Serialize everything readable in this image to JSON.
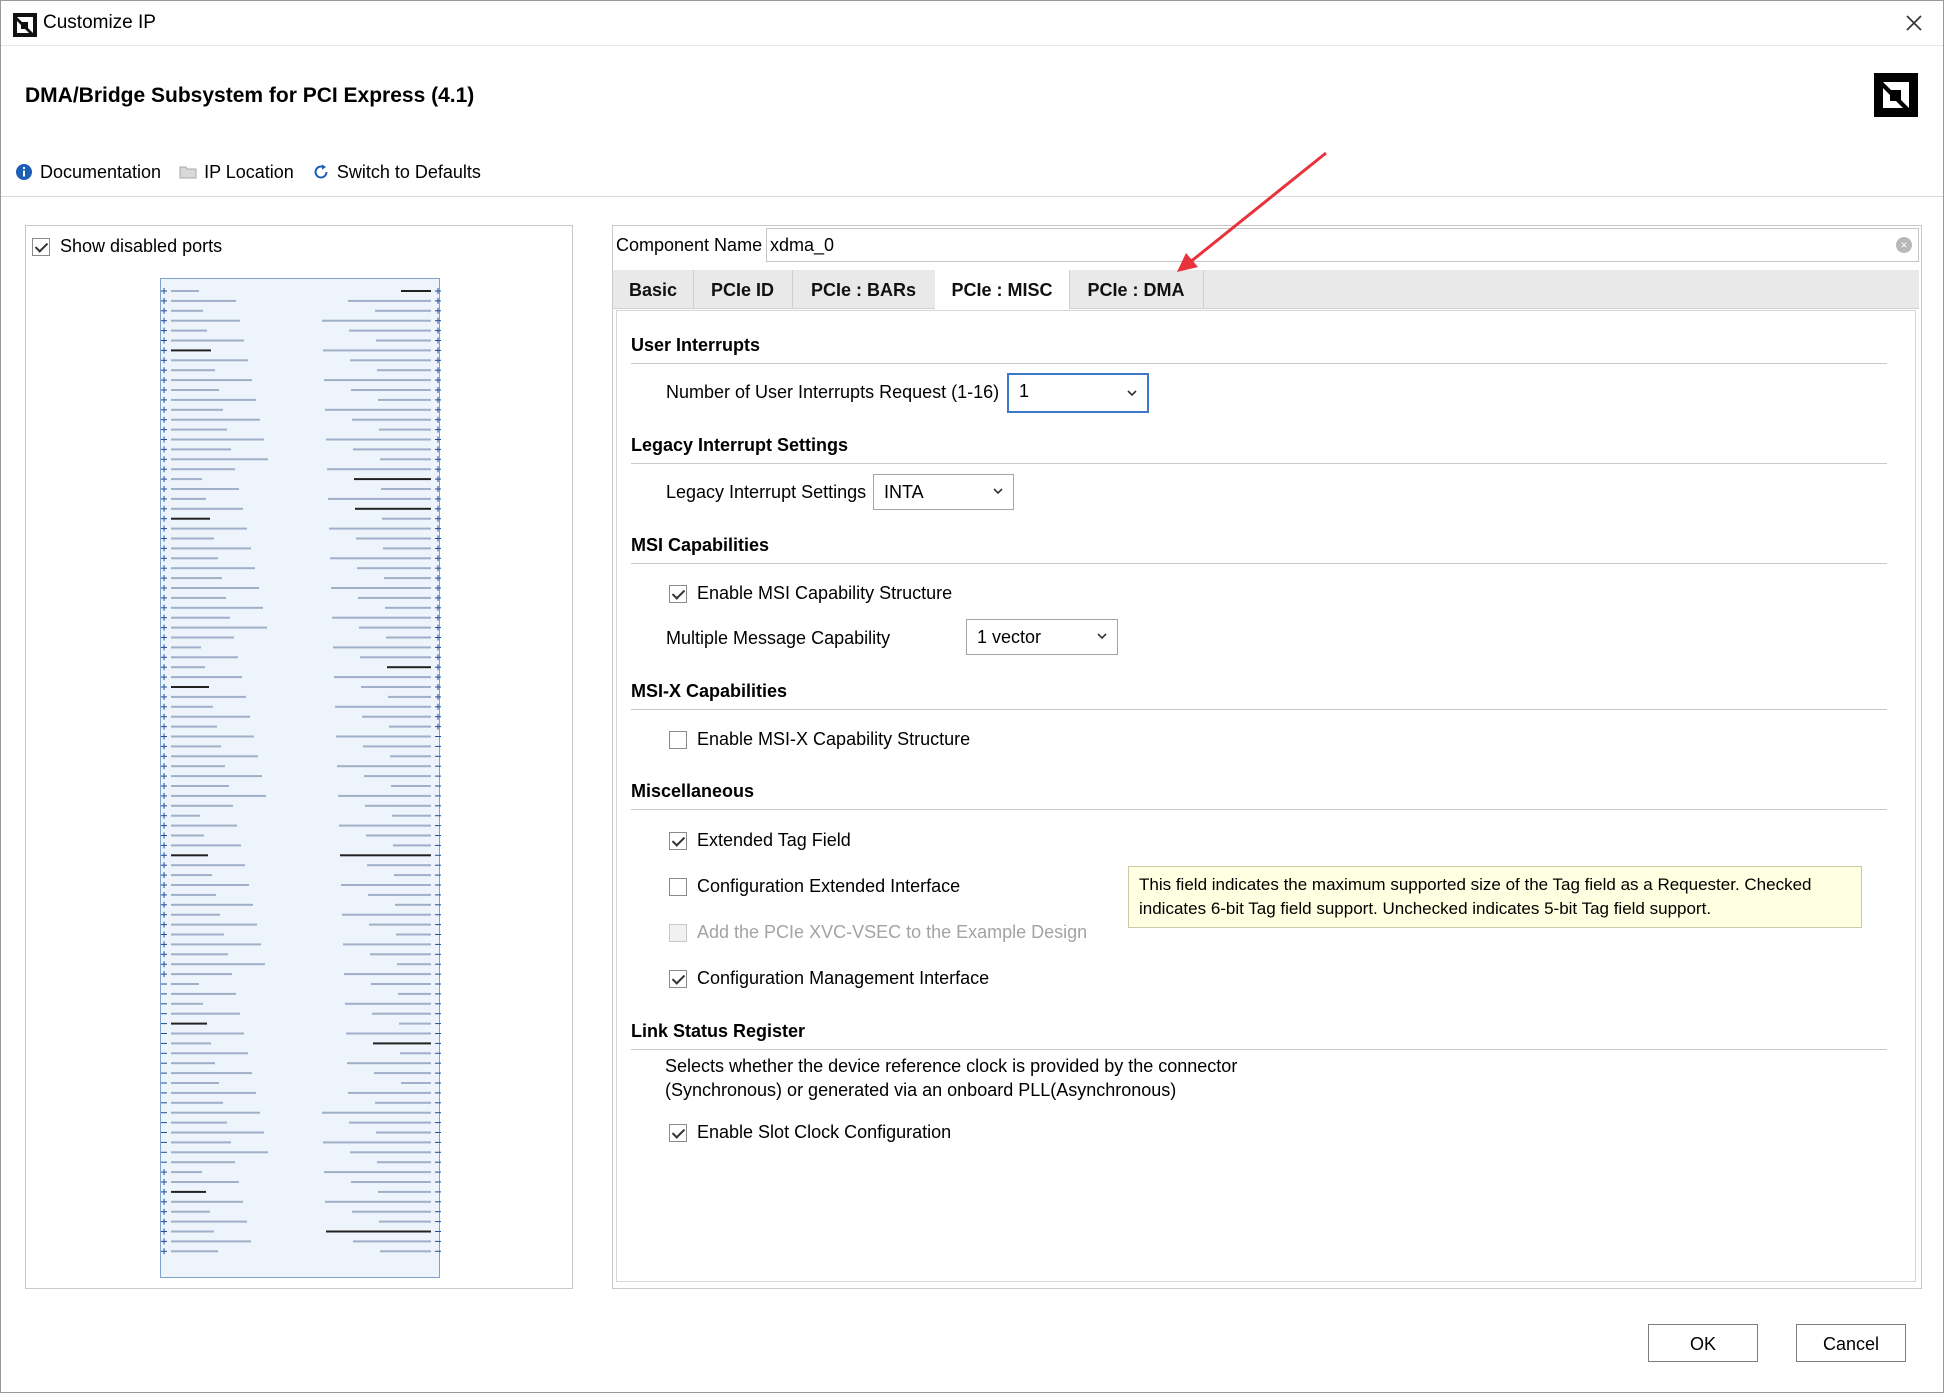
{
  "window": {
    "title": "Customize IP"
  },
  "header": {
    "ip_title": "DMA/Bridge Subsystem for PCI Express (4.1)",
    "toolbar": {
      "documentation": "Documentation",
      "ip_location": "IP Location",
      "switch_defaults": "Switch to Defaults"
    }
  },
  "left_panel": {
    "show_disabled_ports": {
      "label": "Show disabled ports",
      "checked": true
    }
  },
  "component": {
    "label": "Component Name",
    "value": "xdma_0"
  },
  "tabs": [
    {
      "label": "Basic",
      "active": false
    },
    {
      "label": "PCIe ID",
      "active": false
    },
    {
      "label": "PCIe : BARs",
      "active": false
    },
    {
      "label": "PCIe : MISC",
      "active": true
    },
    {
      "label": "PCIe : DMA",
      "active": false
    }
  ],
  "sections": {
    "user_interrupts": {
      "title": "User Interrupts",
      "num_label": "Number of User Interrupts Request (1-16)",
      "num_value": "1"
    },
    "legacy": {
      "title": "Legacy Interrupt Settings",
      "label": "Legacy Interrupt Settings",
      "value": "INTA"
    },
    "msi": {
      "title": "MSI Capabilities",
      "enable_label": "Enable MSI Capability Structure",
      "enable_checked": true,
      "mmc_label": "Multiple Message Capability",
      "mmc_value": "1 vector"
    },
    "msix": {
      "title": "MSI-X Capabilities",
      "enable_label": "Enable MSI-X Capability Structure",
      "enable_checked": false
    },
    "misc": {
      "title": "Miscellaneous",
      "ext_tag_label": "Extended Tag Field",
      "ext_tag_checked": true,
      "cfg_ext_label": "Configuration Extended Interface",
      "cfg_ext_checked": false,
      "xvc_label": "Add the PCIe XVC-VSEC to the Example Design",
      "xvc_checked": false,
      "cfg_mgmt_label": "Configuration Management Interface",
      "cfg_mgmt_checked": true
    },
    "link_status": {
      "title": "Link Status Register",
      "desc_line1": "Selects whether the device reference clock is provided by the connector",
      "desc_line2": "(Synchronous) or generated via an onboard PLL(Asynchronous)",
      "slot_clock_label": "Enable Slot Clock Configuration",
      "slot_clock_checked": true
    }
  },
  "tooltip": {
    "line1": "This field indicates the maximum supported size of the Tag field as a Requester. Checked",
    "line2": "indicates 6-bit Tag field support. Unchecked indicates 5-bit Tag field support."
  },
  "footer": {
    "ok": "OK",
    "cancel": "Cancel"
  },
  "colors": {
    "focus": "#3c78c8",
    "tooltip_bg": "#ffffe1",
    "annotation_arrow": "#e8323c"
  },
  "icons": [
    "info-icon",
    "folder-icon",
    "refresh-icon",
    "close-icon",
    "chevron-down-icon",
    "clear-icon"
  ]
}
